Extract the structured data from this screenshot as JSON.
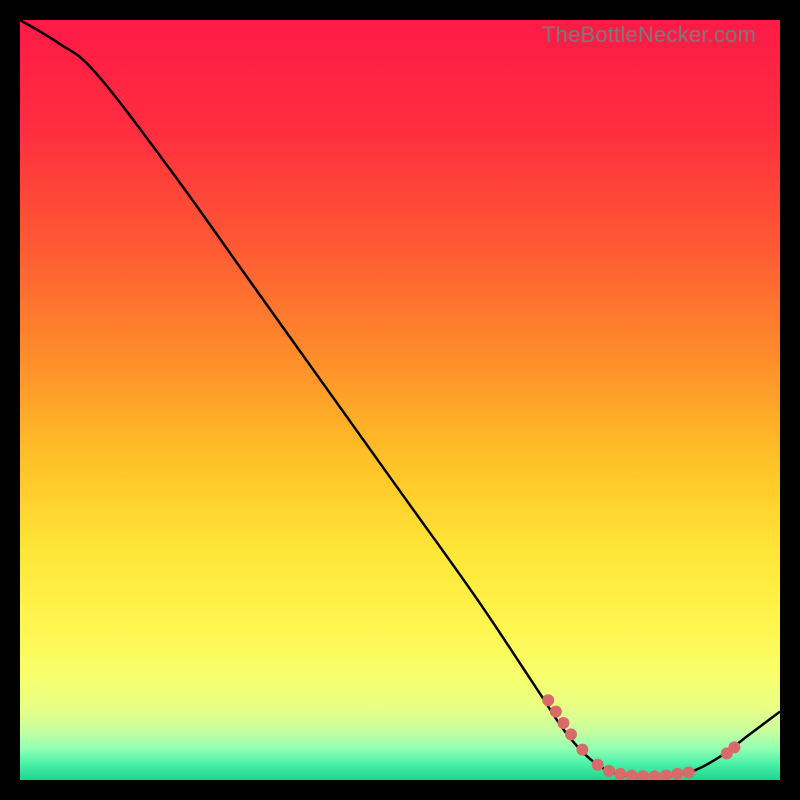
{
  "watermark": "TheBottleNecker.com",
  "chart_data": {
    "type": "line",
    "title": "",
    "xlabel": "",
    "ylabel": "",
    "xlim": [
      0,
      100
    ],
    "ylim": [
      0,
      100
    ],
    "series": [
      {
        "name": "curve",
        "points": [
          {
            "x": 0,
            "y": 100
          },
          {
            "x": 5,
            "y": 97
          },
          {
            "x": 10,
            "y": 93
          },
          {
            "x": 20,
            "y": 80
          },
          {
            "x": 30,
            "y": 66
          },
          {
            "x": 40,
            "y": 52
          },
          {
            "x": 50,
            "y": 38
          },
          {
            "x": 60,
            "y": 24
          },
          {
            "x": 68,
            "y": 12
          },
          {
            "x": 72,
            "y": 6
          },
          {
            "x": 76,
            "y": 2
          },
          {
            "x": 80,
            "y": 0.5
          },
          {
            "x": 84,
            "y": 0.5
          },
          {
            "x": 88,
            "y": 1
          },
          {
            "x": 92,
            "y": 3
          },
          {
            "x": 96,
            "y": 6
          },
          {
            "x": 100,
            "y": 9
          }
        ]
      }
    ],
    "markers": [
      {
        "x": 69.5,
        "y": 10.5
      },
      {
        "x": 70.5,
        "y": 9.0
      },
      {
        "x": 71.5,
        "y": 7.5
      },
      {
        "x": 72.5,
        "y": 6.0
      },
      {
        "x": 74.0,
        "y": 4.0
      },
      {
        "x": 76.0,
        "y": 2.0
      },
      {
        "x": 77.5,
        "y": 1.2
      },
      {
        "x": 79.0,
        "y": 0.8
      },
      {
        "x": 80.5,
        "y": 0.6
      },
      {
        "x": 82.0,
        "y": 0.5
      },
      {
        "x": 83.5,
        "y": 0.5
      },
      {
        "x": 85.0,
        "y": 0.6
      },
      {
        "x": 86.5,
        "y": 0.8
      },
      {
        "x": 88.0,
        "y": 1.0
      },
      {
        "x": 93.0,
        "y": 3.5
      },
      {
        "x": 94.0,
        "y": 4.3
      }
    ],
    "gradient_stops": [
      {
        "offset": 0.0,
        "color": "#ff1a47"
      },
      {
        "offset": 0.15,
        "color": "#ff2f3f"
      },
      {
        "offset": 0.3,
        "color": "#ff5a33"
      },
      {
        "offset": 0.45,
        "color": "#ff8f2a"
      },
      {
        "offset": 0.58,
        "color": "#ffc227"
      },
      {
        "offset": 0.7,
        "color": "#ffe637"
      },
      {
        "offset": 0.8,
        "color": "#fff650"
      },
      {
        "offset": 0.86,
        "color": "#f8ff6a"
      },
      {
        "offset": 0.905,
        "color": "#e8ff85"
      },
      {
        "offset": 0.935,
        "color": "#c8ffa0"
      },
      {
        "offset": 0.96,
        "color": "#8effb4"
      },
      {
        "offset": 0.98,
        "color": "#46f0a6"
      },
      {
        "offset": 1.0,
        "color": "#1fd38e"
      }
    ],
    "marker_color": "#d86a6a",
    "curve_color": "#000000"
  }
}
